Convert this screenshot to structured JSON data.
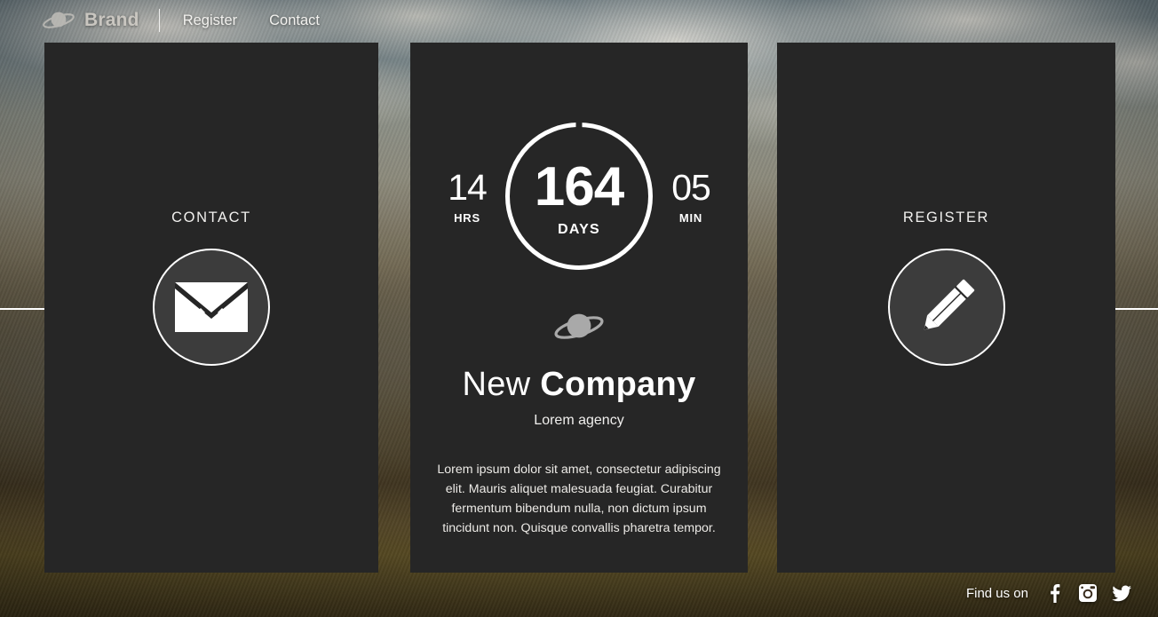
{
  "navbar": {
    "brand_icon": "planet-saturn-icon",
    "brand_label": "Brand",
    "links": [
      {
        "label": "Register"
      },
      {
        "label": "Contact"
      }
    ]
  },
  "panels": {
    "left": {
      "title": "CONTACT",
      "icon": "envelope-icon"
    },
    "right": {
      "title": "REGISTER",
      "icon": "pencil-icon"
    },
    "center": {
      "countdown": {
        "hours": {
          "value": "14",
          "label": "HRS"
        },
        "days": {
          "value": "164",
          "label": "DAYS"
        },
        "minutes": {
          "value": "05",
          "label": "MIN"
        }
      },
      "logo_icon": "planet-saturn-icon",
      "company_name_thin": "New",
      "company_name_bold": "Company",
      "tagline": "Lorem agency",
      "blurb": "Lorem ipsum dolor sit amet, consectetur adipiscing elit. Mauris aliquet malesuada feugiat. Curabitur fermentum bibendum nulla, non dictum ipsum tincidunt non. Quisque convallis pharetra tempor."
    }
  },
  "footer": {
    "label": "Find us on",
    "socials": [
      {
        "name": "facebook-icon"
      },
      {
        "name": "instagram-icon"
      },
      {
        "name": "twitter-icon"
      }
    ]
  },
  "colors": {
    "panel_bg": "#262626",
    "circle_bg": "#3c3c3c",
    "accent_white": "#ffffff",
    "brand_text": "#c9c6c0"
  }
}
